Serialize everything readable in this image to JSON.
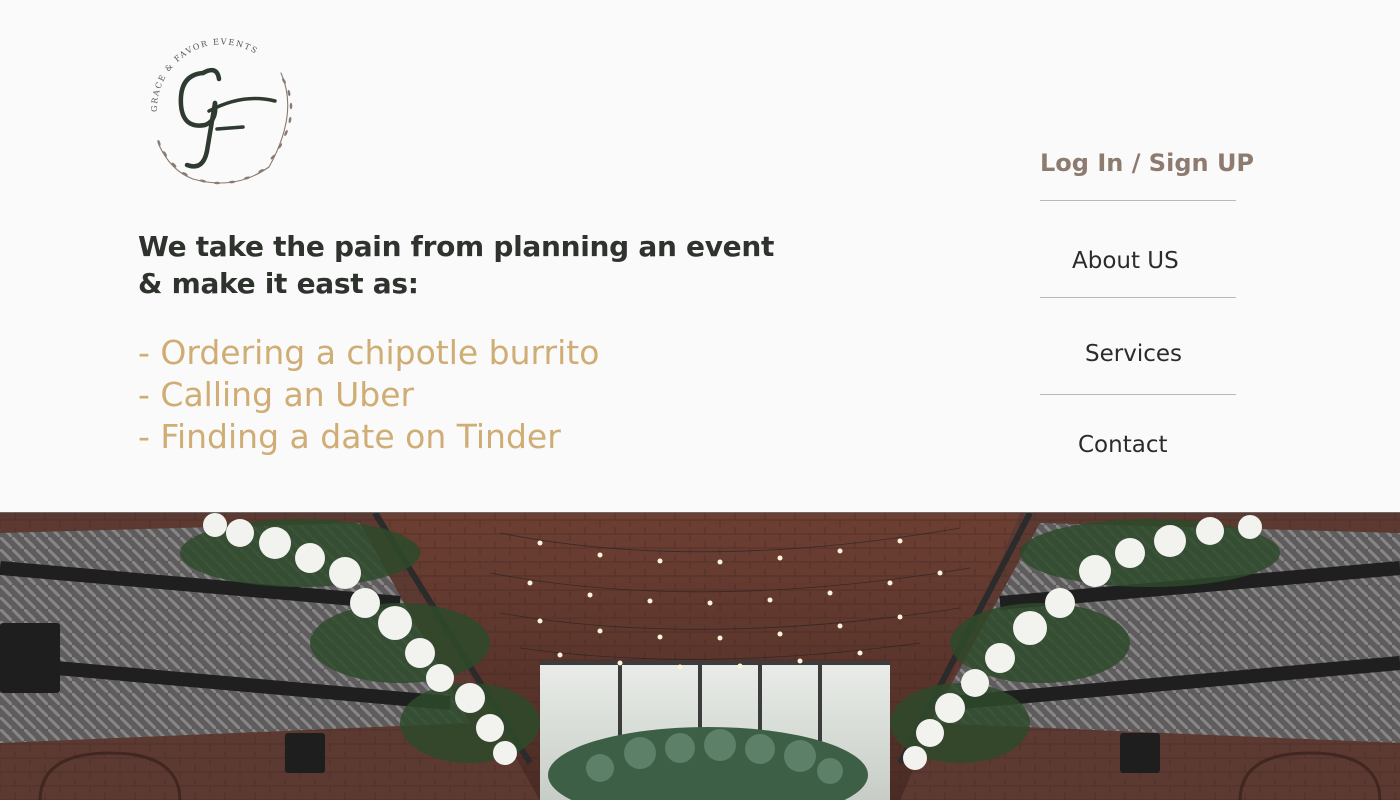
{
  "brand": {
    "logo_icon": "grace-favor-monogram-logo",
    "ring_text": "GRACE & FAVOR EVENTS",
    "monogram": "GF"
  },
  "hero": {
    "headline_line1": "We take the pain from planning an event",
    "headline_line2": "& make it east as:",
    "benefits": [
      "- Ordering a chipotle burrito",
      "- Calling an Uber",
      "- Finding a date on Tinder"
    ]
  },
  "nav": {
    "login_label": "Log In / Sign UP",
    "about_label": "About US",
    "services_label": "Services",
    "contact_label": "Contact"
  },
  "photo": {
    "subject": "event-venue-photo"
  },
  "colors": {
    "background": "#fafafa",
    "headline": "#2f332e",
    "accent_gold": "#cfad74",
    "login_taupe": "#8e7b70",
    "nav_text": "#2b2b2b",
    "divider": "#b9b9b9"
  }
}
